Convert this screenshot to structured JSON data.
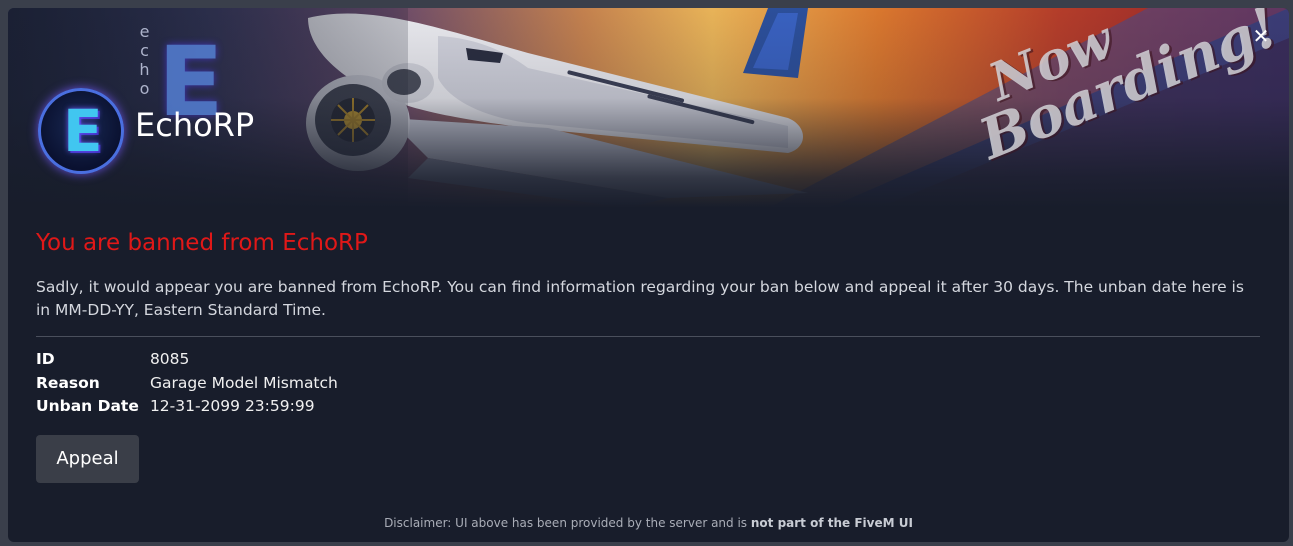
{
  "banner": {
    "server_name": "EchoRP",
    "logo_letter": "E",
    "logo_vertical_text": "echo",
    "tagline_line1": "Now",
    "tagline_line2": "Boarding!",
    "close_icon": "close-icon"
  },
  "ban": {
    "title": "You are banned from EchoRP",
    "description": "Sadly, it would appear you are banned from EchoRP. You can find information regarding your ban below and appeal it after 30 days. The unban date here is in MM-DD-YY, Eastern Standard Time.",
    "fields": [
      {
        "label": "ID",
        "value": "8085"
      },
      {
        "label": "Reason",
        "value": "Garage Model Mismatch"
      },
      {
        "label": "Unban Date",
        "value": "12-31-2099 23:59:99"
      }
    ],
    "appeal_label": "Appeal"
  },
  "footer": {
    "disclaimer_prefix": "Disclaimer: UI above has been provided by the server and is ",
    "disclaimer_bold": "not part of the FiveM UI"
  },
  "colors": {
    "title_red": "#e01818",
    "background": "#181d2b",
    "button_bg": "#3a3e48"
  }
}
